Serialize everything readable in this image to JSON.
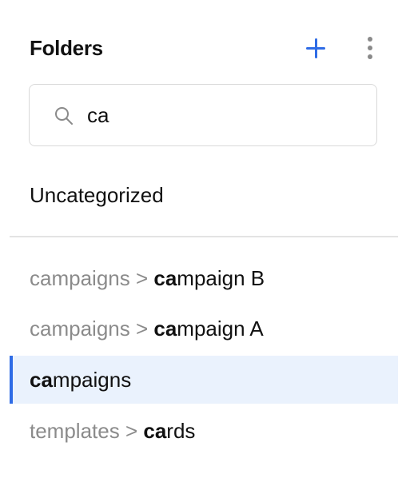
{
  "header": {
    "title": "Folders",
    "add_icon": "plus-icon",
    "more_icon": "vertical-ellipsis-icon"
  },
  "search": {
    "value": "ca",
    "icon": "search-icon"
  },
  "uncategorized_label": "Uncategorized",
  "results": [
    {
      "path": "campaigns > ",
      "match": "ca",
      "rest": "mpaign B",
      "selected": false
    },
    {
      "path": "campaigns > ",
      "match": "ca",
      "rest": "mpaign A",
      "selected": false
    },
    {
      "path": "",
      "match": "ca",
      "rest": "mpaigns",
      "selected": true
    },
    {
      "path": "templates > ",
      "match": "ca",
      "rest": "rds",
      "selected": false
    }
  ],
  "colors": {
    "accent": "#2f6ce6",
    "selected_bg": "#eaf2fd",
    "path_text": "#8b8b8b"
  }
}
